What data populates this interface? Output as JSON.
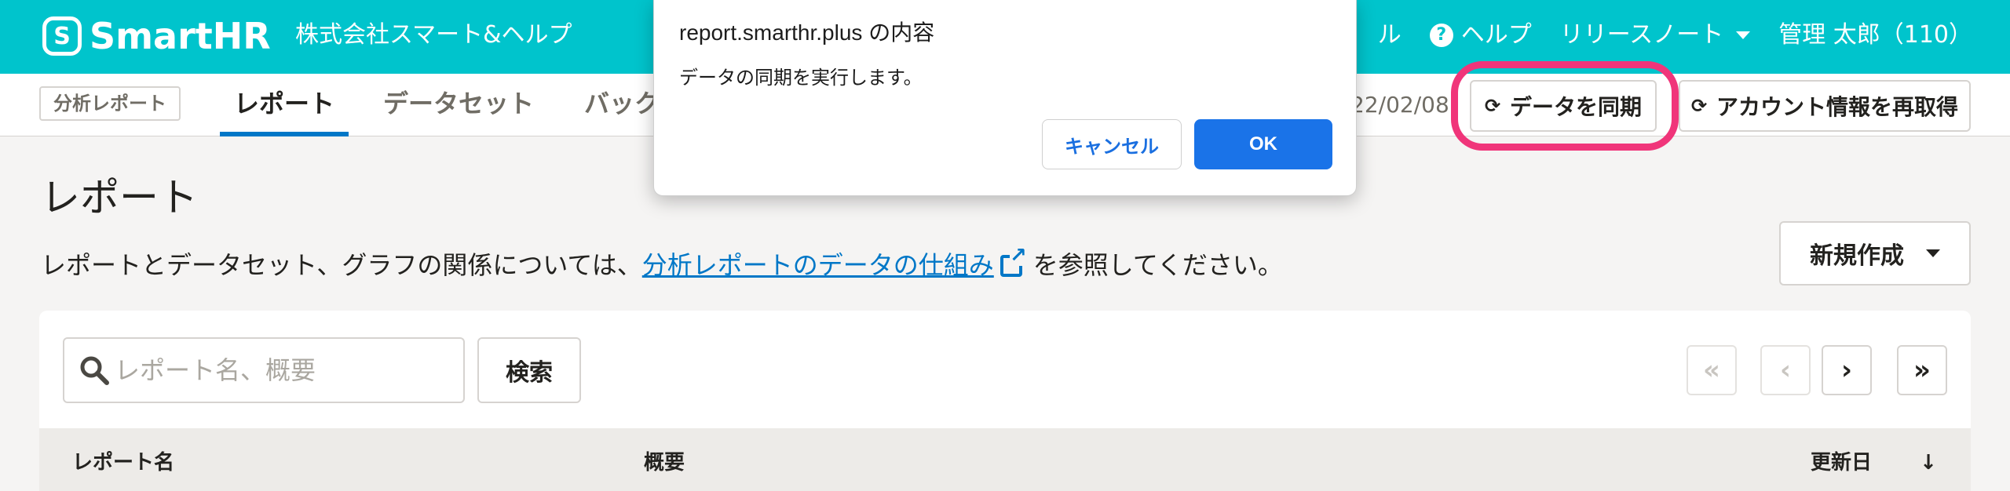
{
  "header": {
    "logo_mark": "S",
    "logo_text": "SmartHR",
    "company": "株式会社スマート&ヘルプ",
    "partial_item": "ル",
    "help": "ヘルプ",
    "release_notes": "リリースノート",
    "user": "管理 太郎（110）",
    "bg_color": "#00c4cc"
  },
  "subnav": {
    "badge": "分析レポート",
    "tabs": [
      {
        "label": "レポート",
        "active": true
      },
      {
        "label": "データセット",
        "active": false
      },
      {
        "label": "バック",
        "active": false
      }
    ],
    "date_partial": "22/02/08",
    "sync_button": "データを同期",
    "refetch_button": "アカウント情報を再取得"
  },
  "main": {
    "title": "レポート",
    "desc_before": "レポートとデータセット、グラフの関係については、",
    "desc_link": "分析レポートのデータの仕組み",
    "desc_after": "を参照してください。",
    "new_button": "新規作成"
  },
  "search": {
    "placeholder": "レポート名、概要",
    "button": "検索"
  },
  "pagination": {
    "first": "«",
    "prev": "‹",
    "next": "›",
    "last": "»"
  },
  "table": {
    "columns": [
      "レポート名",
      "概要",
      "更新日"
    ],
    "sort_indicator": "↓"
  },
  "dialog": {
    "title": "report.smarthr.plus の内容",
    "message": "データの同期を実行します。",
    "cancel": "キャンセル",
    "ok": "OK"
  },
  "colors": {
    "accent": "#0077c7",
    "highlight": "#f0357a",
    "dialog_ok": "#1a73e8"
  }
}
